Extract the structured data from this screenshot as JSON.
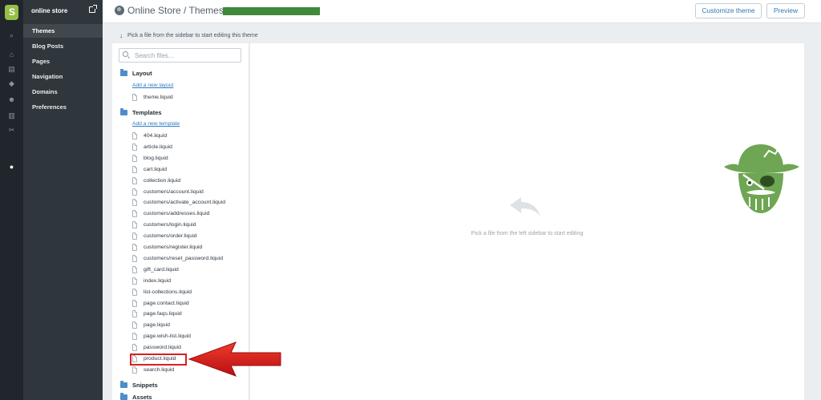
{
  "sidebar": {
    "store_name": "online store",
    "items": [
      {
        "label": "Themes",
        "active": true
      },
      {
        "label": "Blog Posts",
        "active": false
      },
      {
        "label": "Pages",
        "active": false
      },
      {
        "label": "Navigation",
        "active": false
      },
      {
        "label": "Domains",
        "active": false
      },
      {
        "label": "Preferences",
        "active": false
      }
    ]
  },
  "header": {
    "breadcrumb": "Online Store / Themes /",
    "customize_label": "Customize theme",
    "preview_label": "Preview"
  },
  "hint": "Pick a file from the sidebar to start editing this theme",
  "files": {
    "search_placeholder": "Search files...",
    "layout": {
      "label": "Layout",
      "add_link": "Add a new layout",
      "items": [
        "theme.liquid"
      ]
    },
    "templates": {
      "label": "Templates",
      "add_link": "Add a new template",
      "items": [
        "404.liquid",
        "article.liquid",
        "blog.liquid",
        "cart.liquid",
        "collection.liquid",
        "customers/account.liquid",
        "customers/activate_account.liquid",
        "customers/addresses.liquid",
        "customers/login.liquid",
        "customers/order.liquid",
        "customers/register.liquid",
        "customers/reset_password.liquid",
        "gift_card.liquid",
        "index.liquid",
        "list-collections.liquid",
        "page.contact.liquid",
        "page.faqs.liquid",
        "page.liquid",
        "page.wish-list.liquid",
        "password.liquid",
        "product.liquid",
        "search.liquid"
      ]
    },
    "snippets_label": "Snippets",
    "assets_label": "Assets"
  },
  "editor": {
    "empty_text": "Pick a file from the left sidebar to start editing"
  },
  "colors": {
    "accent": "#2e7bc4",
    "highlight": "#d81f1f",
    "redacted": "#3e8a3a",
    "mascot": "#6ea653"
  }
}
